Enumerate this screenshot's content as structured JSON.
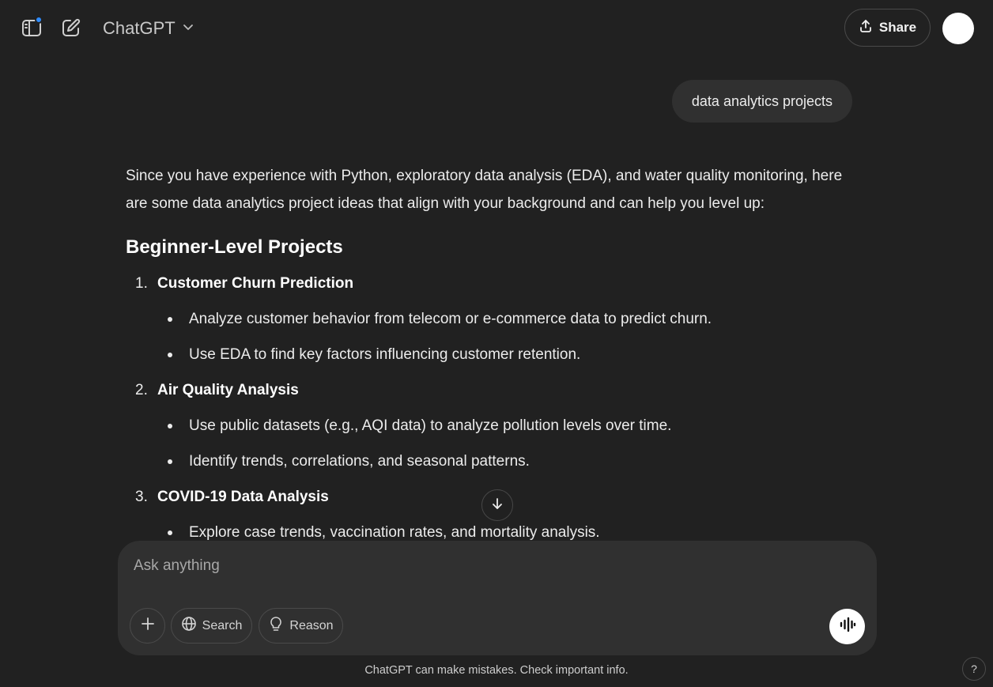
{
  "header": {
    "model_name": "ChatGPT",
    "share_label": "Share",
    "icons": [
      "sidebar-toggle-icon",
      "new-chat-icon",
      "chevron-down-icon",
      "share-icon"
    ]
  },
  "conversation": {
    "user_message": "data analytics projects",
    "intro": "Since you have experience with Python, exploratory data analysis (EDA), and water quality monitoring, here are some data analytics project ideas that align with your background and can help you level up:",
    "section_heading": "Beginner-Level Projects",
    "projects": [
      {
        "number": "1.",
        "title": "Customer Churn Prediction",
        "bullets": [
          "Analyze customer behavior from telecom or e-commerce data to predict churn.",
          "Use EDA to find key factors influencing customer retention."
        ]
      },
      {
        "number": "2.",
        "title": "Air Quality Analysis",
        "bullets": [
          "Use public datasets (e.g., AQI data) to analyze pollution levels over time.",
          "Identify trends, correlations, and seasonal patterns."
        ]
      },
      {
        "number": "3.",
        "title": "COVID-19 Data Analysis",
        "bullets": [
          "Explore case trends, vaccination rates, and mortality analysis."
        ]
      }
    ]
  },
  "composer": {
    "placeholder": "Ask anything",
    "search_label": "Search",
    "reason_label": "Reason"
  },
  "footer": {
    "disclaimer": "ChatGPT can make mistakes. Check important info.",
    "help_label": "?"
  },
  "colors": {
    "background": "#212121",
    "bubble": "#303030",
    "accent_dot": "#2f8cff"
  }
}
